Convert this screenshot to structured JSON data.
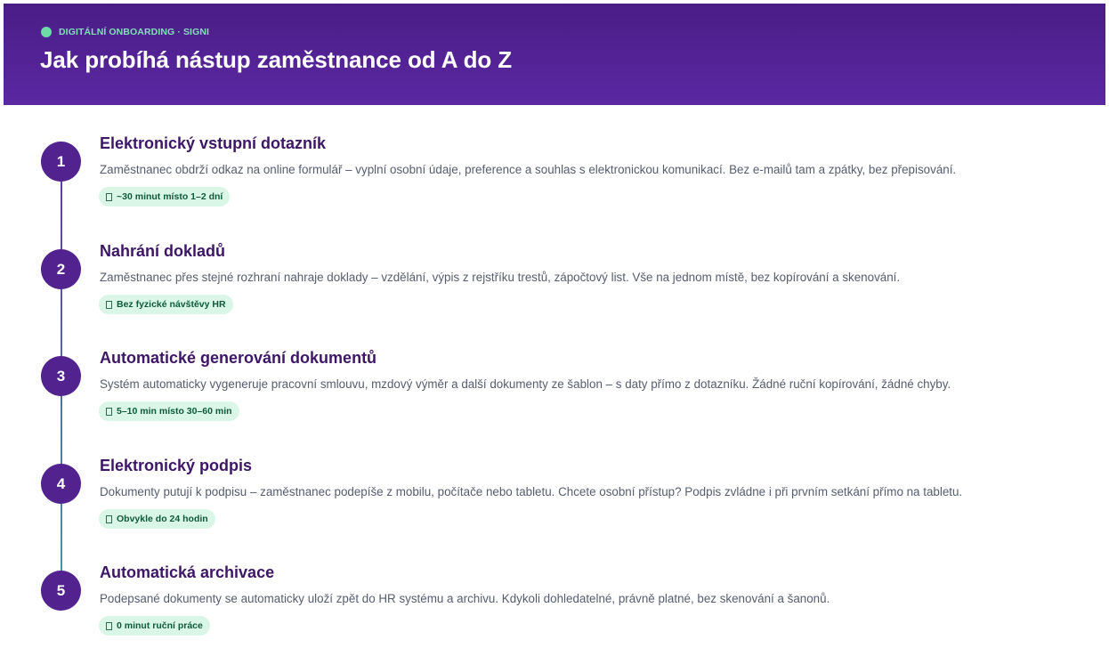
{
  "header": {
    "eyebrow": "DIGITÁLNÍ ONBOARDING · SIGNI",
    "title": "Jak probíhá nástup zaměstnance od A do Z"
  },
  "steps": [
    {
      "number": "1",
      "title": "Elektronický vstupní dotazník",
      "description": "Zaměstnanec obdrží odkaz na online formulář – vyplní osobní údaje, preference a souhlas s elektronickou komunikací. Bez e-mailů tam a zpátky, bez přepisování.",
      "badge": "~30 minut místo 1–2 dní"
    },
    {
      "number": "2",
      "title": "Nahrání dokladů",
      "description": "Zaměstnanec přes stejné rozhraní nahraje doklady – vzdělání, výpis z rejstříku trestů, zápočtový list. Vše na jednom místě, bez kopírování a skenování.",
      "badge": "Bez fyzické návštěvy HR"
    },
    {
      "number": "3",
      "title": "Automatické generování dokumentů",
      "description": "Systém automaticky vygeneruje pracovní smlouvu, mzdový výměr a další dokumenty ze šablon – s daty přímo z dotazníku. Žádné ruční kopírování, žádné chyby.",
      "badge": "5–10 min místo 30–60 min"
    },
    {
      "number": "4",
      "title": "Elektronický podpis",
      "description": "Dokumenty putují k podpisu – zaměstnanec podepíše z mobilu, počítače nebo tabletu. Chcete osobní přístup? Podpis zvládne i při prvním setkání přímo na tabletu.",
      "badge": "Obvykle do 24 hodin"
    },
    {
      "number": "5",
      "title": "Automatická archivace",
      "description": "Podepsané dokumenty se automaticky uloží zpět do HR systému a archivu. Kdykoli dohledatelné, právně platné, bez skenování a šanonů.",
      "badge": "0 minut ruční práce"
    }
  ],
  "colors": {
    "header_start": "#4a1d86",
    "header_end": "#5a28a2",
    "accent_green": "#6ddba8",
    "step_circle": "#52238f",
    "step_title": "#3d1668",
    "badge_bg": "#d9f6e7",
    "badge_text": "#0f5a3a"
  },
  "icons": {
    "eyebrow": "status-dot-icon",
    "badge": "missing-glyph-icon"
  }
}
